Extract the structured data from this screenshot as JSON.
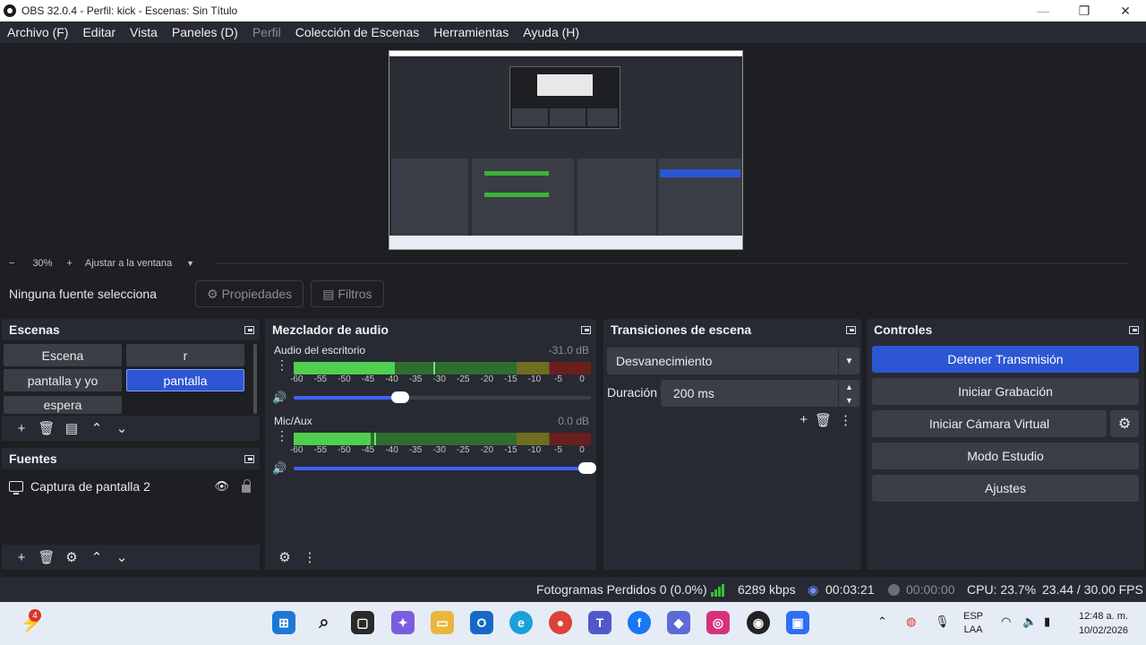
{
  "window": {
    "title": "OBS 32.0.4 - Perfil: kick - Escenas: Sin Título"
  },
  "menu": [
    "Archivo (F)",
    "Editar",
    "Vista",
    "Paneles (D)",
    "Perfil",
    "Colección de Escenas",
    "Herramientas",
    "Ayuda (H)"
  ],
  "zoom": {
    "minus": "−",
    "level": "30%",
    "plus": "+",
    "fit_label": "Ajustar a la ventana"
  },
  "source_toolbar": {
    "no_source": "Ninguna fuente selecciona",
    "properties": "Propiedades",
    "filters": "Filtros"
  },
  "scenes": {
    "title": "Escenas",
    "items": [
      "Escena",
      "r",
      "pantalla y yo",
      "pantalla",
      "espera"
    ],
    "active": "pantalla"
  },
  "sources": {
    "title": "Fuentes",
    "items": [
      {
        "name": "Captura de pantalla 2",
        "visible": true,
        "locked": true
      }
    ]
  },
  "mixer": {
    "title": "Mezclador de audio",
    "scale": [
      "-60",
      "-55",
      "-50",
      "-45",
      "-40",
      "-35",
      "-30",
      "-25",
      "-20",
      "-15",
      "-10",
      "-5",
      "0"
    ],
    "channels": [
      {
        "name": "Audio del escritorio",
        "db": "-31.0 dB",
        "level": 0.34,
        "peak": 0.47,
        "volume": 0.37
      },
      {
        "name": "Mic/Aux",
        "db": "0.0 dB",
        "level": 0.26,
        "peak": 0.27,
        "volume": 1.0
      }
    ]
  },
  "transitions": {
    "title": "Transiciones de escena",
    "selected": "Desvanecimiento",
    "duration_label": "Duración",
    "duration_value": "200 ms"
  },
  "controls": {
    "title": "Controles",
    "stop_stream": "Detener Transmisión",
    "start_recording": "Iniciar Grabación",
    "start_virtual_cam": "Iniciar Cámara Virtual",
    "studio_mode": "Modo Estudio",
    "settings": "Ajustes"
  },
  "status": {
    "dropped_frames": "Fotogramas Perdidos 0 (0.0%)",
    "bitrate": "6289 kbps",
    "stream_time": "00:03:21",
    "rec_time": "00:00:00",
    "cpu": "CPU: 23.7%",
    "fps": "23.44 / 30.00 FPS"
  },
  "taskbar": {
    "notification_count": "4",
    "lang_line1": "ESP",
    "lang_line2": "LAA",
    "time": "12:48 a. m.",
    "date": "10/02/2026"
  },
  "colors": {
    "accent": "#2c56d4",
    "panel": "#272a33",
    "background": "#1e1f22"
  }
}
